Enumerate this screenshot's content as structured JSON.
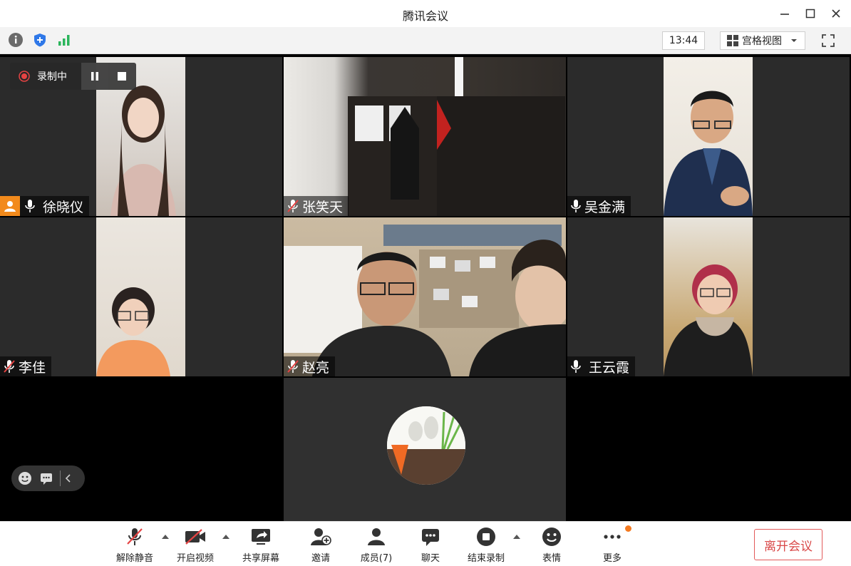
{
  "window": {
    "title": "腾讯会议"
  },
  "toolbar": {
    "time": "13:44",
    "view_mode_label": "宫格视图"
  },
  "recording": {
    "status_label": "录制中"
  },
  "participants": [
    {
      "name": "徐晓仪",
      "mic": "on",
      "host": true
    },
    {
      "name": "张笑天",
      "mic": "muted",
      "host": false
    },
    {
      "name": "吴金满",
      "mic": "on",
      "host": false
    },
    {
      "name": "李佳",
      "mic": "muted",
      "host": false
    },
    {
      "name": "赵亮",
      "mic": "muted",
      "host": false
    },
    {
      "name": "王云霞",
      "mic": "on",
      "host": false
    }
  ],
  "controls": {
    "unmute": "解除静音",
    "start_video": "开启视频",
    "share_screen": "共享屏幕",
    "invite": "邀请",
    "members": "成员(7)",
    "chat": "聊天",
    "end_recording": "结束录制",
    "reactions": "表情",
    "more": "更多",
    "leave": "离开会议"
  },
  "colors": {
    "host_badge": "#f28a1c",
    "leave_red": "#d94848",
    "notify": "#f47a20"
  }
}
